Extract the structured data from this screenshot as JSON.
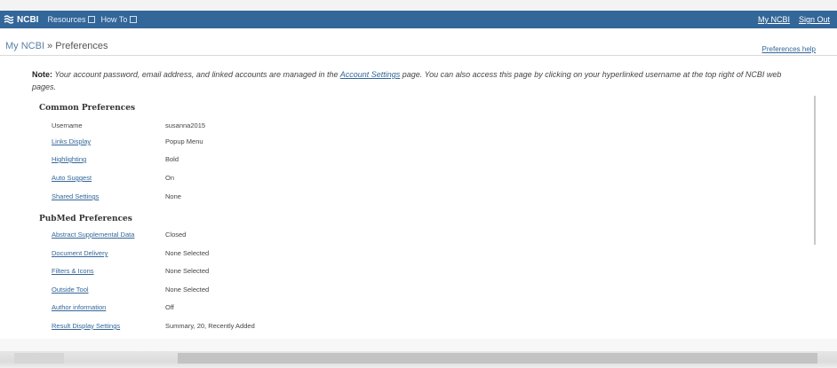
{
  "navbar": {
    "logo_label": "NCBI",
    "menu_resources": "Resources",
    "menu_howto": "How To",
    "my_ncbi_link": "My NCBI",
    "sign_out_link": "Sign Out",
    "bg_color": "#336699"
  },
  "breadcrumb": {
    "root": "My NCBI",
    "separator": " » ",
    "current": "Preferences"
  },
  "help_link": "Preferences help",
  "note": {
    "prefix": "Note:",
    "text_before_link": " Your account password, email address, and linked accounts are managed in the ",
    "link": "Account Settings",
    "text_after_link": " page. You can also access this page by clicking on your hyperlinked username at the top right of NCBI web pages."
  },
  "common_preferences": {
    "title": "Common Preferences",
    "rows": [
      {
        "label": "Username",
        "value": "susanna2015",
        "is_link": false
      },
      {
        "label": "Links Display",
        "value": "Popup Menu",
        "is_link": true
      },
      {
        "label": "Highlighting",
        "value": "Bold",
        "is_link": true
      },
      {
        "label": "Auto Suggest",
        "value": "On",
        "is_link": true
      },
      {
        "label": "Shared Settings",
        "value": "None",
        "is_link": true
      }
    ]
  },
  "pubmed_preferences": {
    "title": "PubMed Preferences",
    "rows": [
      {
        "label": "Abstract Supplemental Data",
        "value": "Closed",
        "is_link": true
      },
      {
        "label": "Document Delivery",
        "value": "None Selected",
        "is_link": true
      },
      {
        "label": "Filters & Icons",
        "value": "None Selected",
        "is_link": true
      },
      {
        "label": "Outside Tool",
        "value": "None Selected",
        "is_link": true
      },
      {
        "label": "Author information",
        "value": "Off",
        "is_link": true
      },
      {
        "label": "Result Display Settings",
        "value": "Summary, 20, Recently Added",
        "is_link": true
      }
    ]
  }
}
